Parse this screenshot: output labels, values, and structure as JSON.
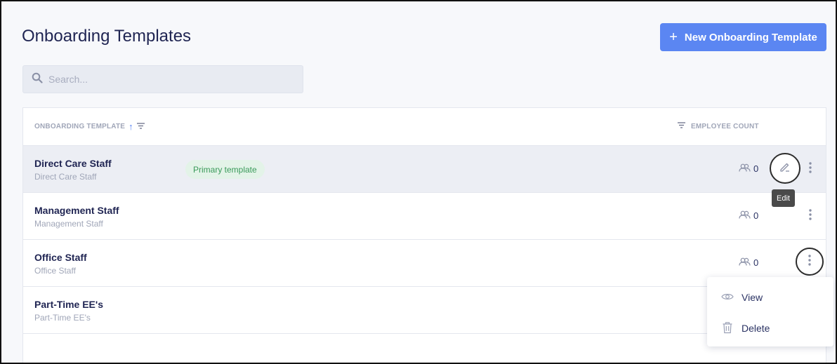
{
  "header": {
    "title": "Onboarding Templates",
    "new_button_label": "New Onboarding Template",
    "new_button_icon": "plus-icon"
  },
  "search": {
    "placeholder": "Search...",
    "value": ""
  },
  "table": {
    "columns": {
      "name": "ONBOARDING TEMPLATE",
      "count": "EMPLOYEE COUNT"
    },
    "rows": [
      {
        "name": "Direct Care Staff",
        "subtitle": "Direct Care Staff",
        "badge": "Primary template",
        "count": "0"
      },
      {
        "name": "Management Staff",
        "subtitle": "Management Staff",
        "count": "0"
      },
      {
        "name": "Office Staff",
        "subtitle": "Office Staff",
        "count": "0"
      },
      {
        "name": "Part-Time EE's",
        "subtitle": "Part-Time EE's"
      }
    ]
  },
  "tooltip": {
    "edit": "Edit"
  },
  "menu": {
    "items": [
      {
        "label": "View",
        "icon": "eye-icon"
      },
      {
        "label": "Delete",
        "icon": "trash-icon"
      }
    ]
  },
  "colors": {
    "accent": "#5b86f2",
    "title": "#1f2452",
    "badge_bg": "#e3f3e8",
    "badge_text": "#3a9a5a",
    "muted": "#a0a6b8"
  }
}
